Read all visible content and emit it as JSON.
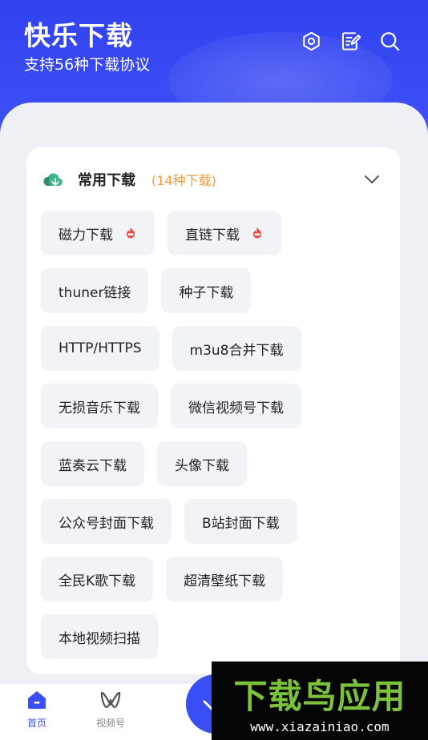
{
  "header": {
    "title": "快乐下载",
    "subtitle": "支持56种下载协议",
    "icons": [
      "settings-icon",
      "notes-icon",
      "search-icon"
    ]
  },
  "card": {
    "title": "常用下载",
    "count": "(14种下载)",
    "icon": "cloud-icon",
    "collapse_icon": "chevron-down-icon",
    "rows": [
      [
        {
          "label": "磁力下载",
          "hot": true
        },
        {
          "label": "直链下载",
          "hot": true
        }
      ],
      [
        {
          "label": "thuner链接"
        },
        {
          "label": "种子下载"
        }
      ],
      [
        {
          "label": "HTTP/HTTPS"
        },
        {
          "label": "m3u8合并下载"
        }
      ],
      [
        {
          "label": "无损音乐下载"
        },
        {
          "label": "微信视频号下载"
        }
      ],
      [
        {
          "label": "蓝奏云下载"
        },
        {
          "label": "头像下载"
        }
      ],
      [
        {
          "label": "公众号封面下载"
        },
        {
          "label": "B站封面下载"
        }
      ],
      [
        {
          "label": "全民K歌下载"
        },
        {
          "label": "超清壁纸下载"
        }
      ],
      [
        {
          "label": "本地视频扫描"
        }
      ]
    ]
  },
  "nav": {
    "home_label": "首页",
    "video_label": "视频号"
  },
  "watermark": {
    "main": "下载鸟应用",
    "url": "www.xiazainiao.com"
  },
  "colors": {
    "brand": "#3a4ef5",
    "accent": "#f29a3a",
    "hot": "#e9453a",
    "cloud": "#3fb58a"
  }
}
